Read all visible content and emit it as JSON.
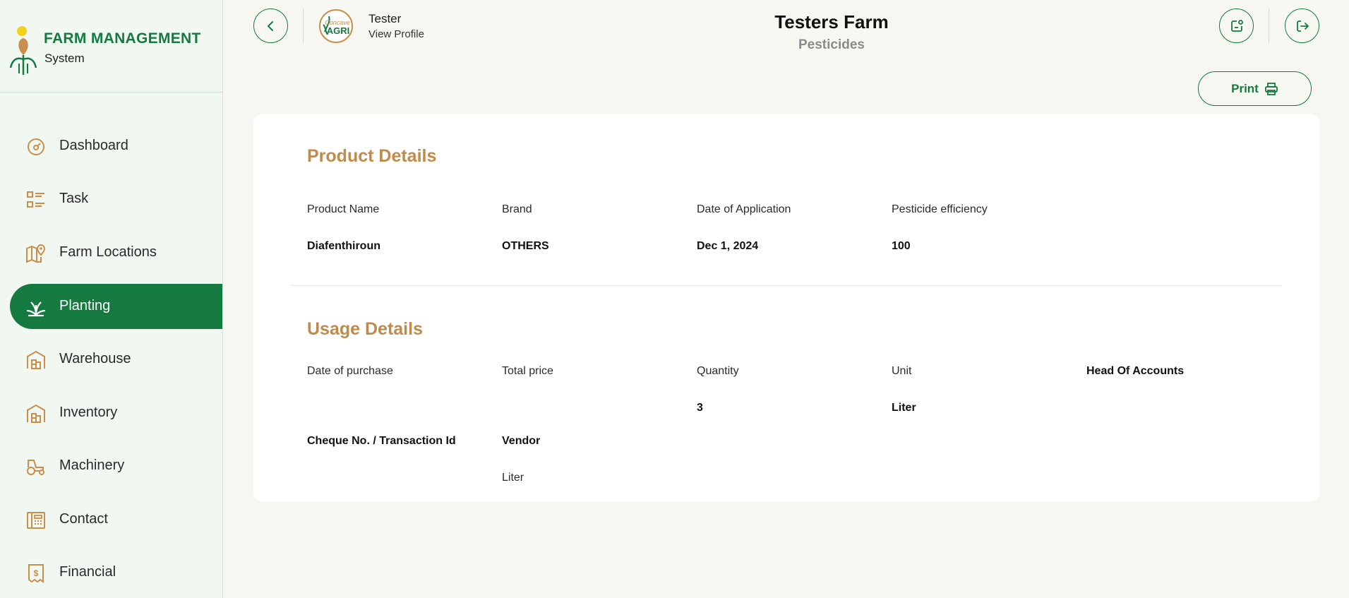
{
  "brand": {
    "title": "FARM MANAGEMENT",
    "subtitle": "System"
  },
  "sidebar": {
    "items": [
      {
        "label": "Dashboard",
        "icon": "dashboard-gauge-icon",
        "active": false
      },
      {
        "label": "Task",
        "icon": "task-list-icon",
        "active": false
      },
      {
        "label": "Farm Locations",
        "icon": "map-pin-icon",
        "active": false
      },
      {
        "label": "Planting",
        "icon": "plant-icon",
        "active": true
      },
      {
        "label": "Warehouse",
        "icon": "warehouse-icon",
        "active": false
      },
      {
        "label": "Inventory",
        "icon": "inventory-icon",
        "active": false
      },
      {
        "label": "Machinery",
        "icon": "tractor-icon",
        "active": false
      },
      {
        "label": "Contact",
        "icon": "contact-icon",
        "active": false
      },
      {
        "label": "Financial",
        "icon": "financial-receipt-icon",
        "active": false
      }
    ]
  },
  "header": {
    "user_name": "Tester",
    "view_profile": "View Profile",
    "avatar_text": "Concave AGRI",
    "farm_title": "Testers Farm",
    "farm_subtitle": "Pesticides"
  },
  "toolbar": {
    "print_label": "Print"
  },
  "product_details": {
    "title": "Product Details",
    "fields": [
      {
        "label": "Product Name",
        "value": "Diafenthiroun"
      },
      {
        "label": "Brand",
        "value": "OTHERS"
      },
      {
        "label": "Date of Application",
        "value": "Dec 1, 2024"
      },
      {
        "label": "Pesticide efficiency",
        "value": "100"
      }
    ]
  },
  "usage_details": {
    "title": "Usage Details",
    "row1": [
      {
        "label": "Date of purchase",
        "value": ""
      },
      {
        "label": "Total price",
        "value": ""
      },
      {
        "label": "Quantity",
        "value": "3"
      },
      {
        "label": "Unit",
        "value": "Liter"
      },
      {
        "label": "Head Of Accounts",
        "value": ""
      }
    ],
    "row2": [
      {
        "label": "Cheque No. / Transaction Id",
        "value": ""
      },
      {
        "label": "Vendor",
        "value": "Liter"
      }
    ]
  },
  "colors": {
    "primary": "#157a3f",
    "accent": "#c08a4a",
    "sidebar_bg": "#f1f8f1",
    "page_bg": "#f7f7f2"
  }
}
